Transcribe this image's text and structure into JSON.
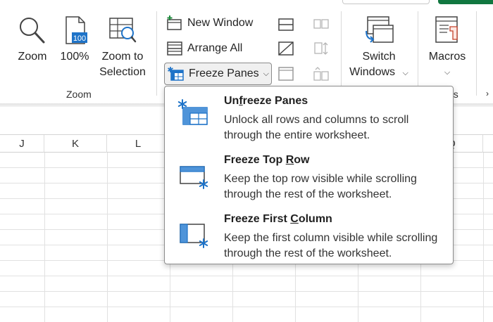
{
  "ribbon": {
    "zoom_group": {
      "label": "Zoom",
      "zoom": "Zoom",
      "hundred": "100%",
      "hundred_icon_text": "100",
      "zoom_to_selection_line1": "Zoom to",
      "zoom_to_selection_line2": "Selection"
    },
    "window_group": {
      "new_window": "New Window",
      "arrange_all": "Arrange All",
      "freeze_panes": "Freeze Panes",
      "switch_windows_line1": "Switch",
      "switch_windows_line2": "Windows",
      "partial_label": "os"
    },
    "macros_group": {
      "macros": "Macros"
    },
    "accent_color": "#117740"
  },
  "sheet": {
    "columns": [
      "J",
      "K",
      "L",
      "Q"
    ]
  },
  "freeze_menu": {
    "items": [
      {
        "title_pre": "Un",
        "title_key": "f",
        "title_post": "reeze Panes",
        "desc": "Unlock all rows and columns to scroll through the entire worksheet."
      },
      {
        "title_pre": "Freeze Top ",
        "title_key": "R",
        "title_post": "ow",
        "desc": "Keep the top row visible while scrolling through the rest of the worksheet."
      },
      {
        "title_pre": "Freeze First ",
        "title_key": "C",
        "title_post": "olumn",
        "desc": "Keep the first column visible while scrolling through the rest of the worksheet."
      }
    ],
    "icon_color": "#1e73c8"
  }
}
